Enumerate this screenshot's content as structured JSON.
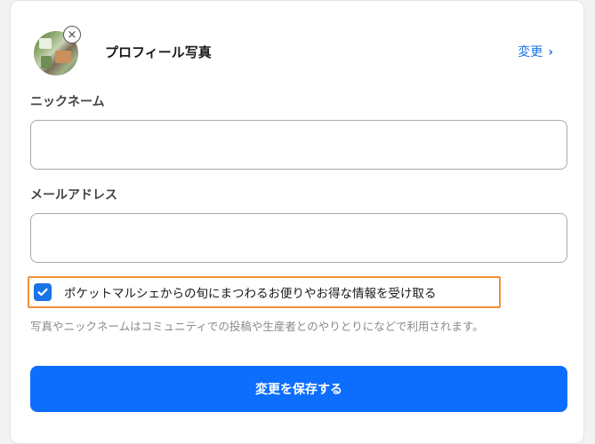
{
  "profile": {
    "title": "プロフィール写真",
    "change_label": "変更",
    "chevron": "›",
    "remove_glyph": "×",
    "avatar_alt": "profile-photo"
  },
  "form": {
    "nickname_label": "ニックネーム",
    "nickname_value": "",
    "email_label": "メールアドレス",
    "email_value": ""
  },
  "opt_in": {
    "label": "ポケットマルシェからの旬にまつわるお便りやお得な情報を受け取る",
    "checked": true
  },
  "note": "写真やニックネームはコミュニティでの投稿や生産者とのやりとりになどで利用されます。",
  "save_button_label": "変更を保存する",
  "colors": {
    "accent": "#0d6efd",
    "link": "#1a73e8",
    "highlight": "#f0913a"
  }
}
